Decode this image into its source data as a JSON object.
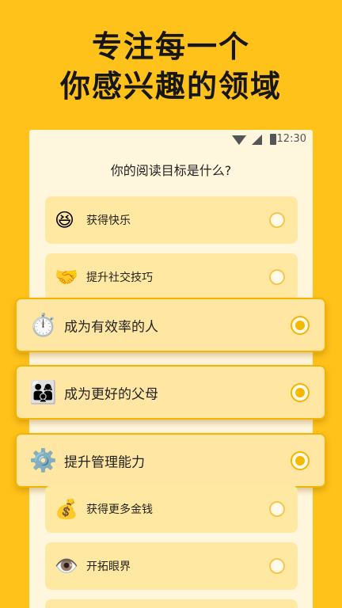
{
  "headline": {
    "line1": "专注每一个",
    "line2": "你感兴趣的领域"
  },
  "statusbar": {
    "time": "12:30"
  },
  "question": "你的阅读目标是什么?",
  "options": [
    {
      "label": "获得快乐",
      "icon": "😆",
      "icon_name": "laughing-face-icon",
      "selected": false
    },
    {
      "label": "提升社交技巧",
      "icon": "🤝",
      "icon_name": "handshake-icon",
      "selected": false
    },
    {
      "label": "成为有效率的人",
      "icon": "⏱️",
      "icon_name": "stopwatch-icon",
      "selected": true
    },
    {
      "label": "成为更好的父母",
      "icon": "👨‍👩‍👦",
      "icon_name": "family-icon",
      "selected": true
    },
    {
      "label": "提升管理能力",
      "icon": "⚙️",
      "icon_name": "gear-icon",
      "selected": true
    },
    {
      "label": "获得更多金钱",
      "icon": "💰",
      "icon_name": "money-bag-icon",
      "selected": false
    },
    {
      "label": "开拓眼界",
      "icon": "👁️",
      "icon_name": "eye-icon",
      "selected": false
    }
  ],
  "colors": {
    "background": "#FFC21A",
    "card": "#FFE9A2",
    "accent": "#F7B800",
    "panel": "#FFF6DE"
  }
}
